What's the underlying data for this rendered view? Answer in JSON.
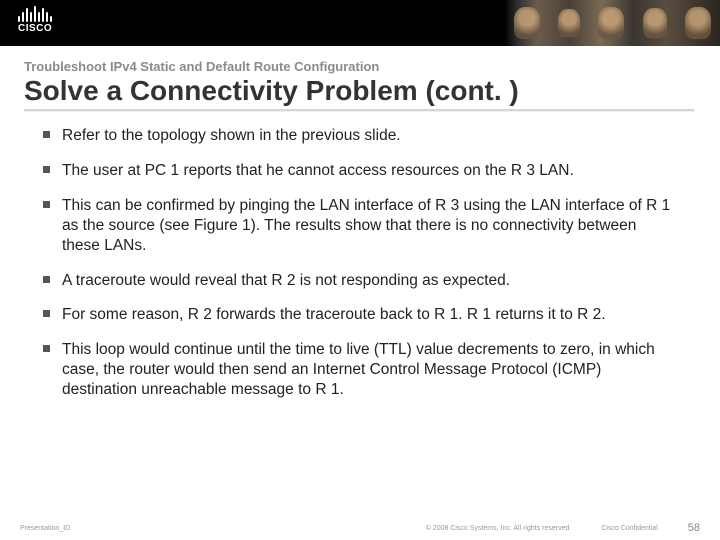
{
  "logo_text": "CISCO",
  "section_label": "Troubleshoot IPv4 Static and Default Route Configuration",
  "title": "Solve a Connectivity Problem (cont. )",
  "bullets": [
    "Refer to the topology shown in the previous slide.",
    "The user at PC 1 reports that he cannot access resources on the R 3 LAN.",
    "This can be confirmed by pinging the LAN interface of R 3 using the LAN interface of R 1 as the source (see Figure 1). The results show that there is no connectivity between these LANs.",
    "A traceroute would reveal that R 2 is not responding as expected.",
    "For some reason, R 2 forwards the traceroute back to R 1. R 1 returns it to R 2.",
    "This loop would continue until the time to live (TTL) value decrements to zero, in which case, the router would then send an Internet Control Message Protocol (ICMP) destination unreachable message to R 1."
  ],
  "footer": {
    "left": "Presentation_ID",
    "center": "© 2008 Cisco Systems, Inc. All rights reserved.",
    "confidential": "Cisco Confidential",
    "page": "58"
  }
}
